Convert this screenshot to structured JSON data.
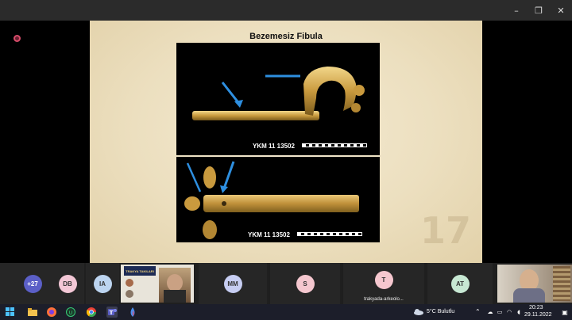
{
  "window": {
    "minimize": "–",
    "restore": "❐",
    "close": "✕"
  },
  "slide": {
    "title": "Bezemesiz Fibula",
    "catalog_top": "YKM 11 13502",
    "catalog_bottom": "YKM 11 13502",
    "page_number": "17",
    "colors": {
      "gold": "#d9b35a",
      "arrow": "#2e8fe0"
    }
  },
  "participants": [
    {
      "initials": "+27",
      "color": "#5b5fc7",
      "text_color": "#ffffff"
    },
    {
      "initials": "DB",
      "color": "#f3c7d6"
    },
    {
      "initials": "IA",
      "color": "#bcd4f0"
    },
    {
      "initials": "MM",
      "color": "#c6cdf2"
    },
    {
      "initials": "S",
      "color": "#f5c7cf"
    },
    {
      "initials": "T",
      "color": "#f5c7cf",
      "name": "trakyada-arkeolo..."
    },
    {
      "initials": "AT",
      "color": "#c7e8d3"
    }
  ],
  "poster": {
    "title": "TRAKYA TAKILARI"
  },
  "taskbar": {
    "weather": "5°C Bulutlu",
    "time": "20:23",
    "date": "29.11.2022",
    "icons": [
      "windows-icon",
      "search-icon",
      "file-explorer-icon",
      "firefox-icon",
      "vpn-icon",
      "chrome-icon",
      "word-icon",
      "teams-icon",
      "droplet-icon"
    ]
  }
}
